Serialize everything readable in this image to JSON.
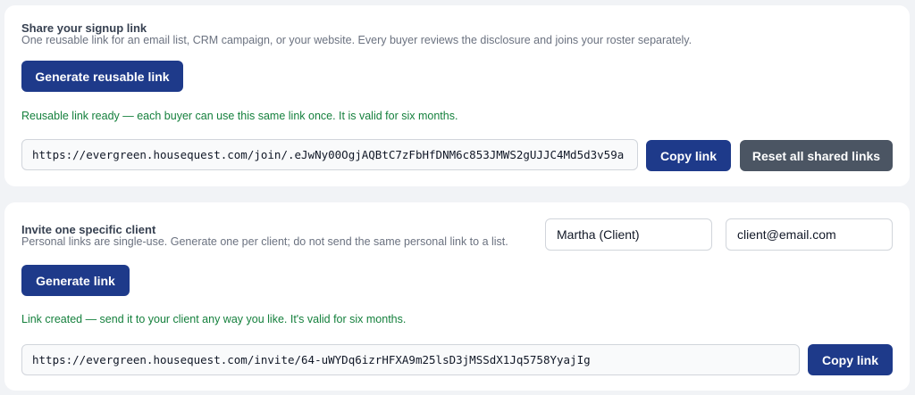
{
  "share": {
    "title": "Share your signup link",
    "description": "One reusable link for an email list, CRM campaign, or your website. Every buyer reviews the disclosure and joins your roster separately.",
    "generate_label": "Generate reusable link",
    "success_message": "Reusable link ready — each buyer can use this same link once. It is valid for six months.",
    "link_value": "https://evergreen.housequest.com/join/.eJwNy00OgjAQBtC7zFbHfDNM6c853JMWS2gUJJC4Md5d3v59a",
    "copy_label": "Copy link",
    "reset_label": "Reset all shared links"
  },
  "invite": {
    "title": "Invite one specific client",
    "description": "Personal links are single-use. Generate one per client; do not send the same personal link to a list.",
    "name_value": "Martha (Client)",
    "email_value": "client@email.com",
    "generate_label": "Generate link",
    "success_message": "Link created — send it to your client any way you like. It's valid for six months.",
    "link_value": "https://evergreen.housequest.com/invite/64-uWYDq6izrHFXA9m25lsD3jMSSdX1Jq5758YyajIg",
    "copy_label": "Copy link"
  },
  "colors": {
    "primary": "#1e3a8a",
    "secondary": "#4b5563",
    "success": "#15803d"
  }
}
